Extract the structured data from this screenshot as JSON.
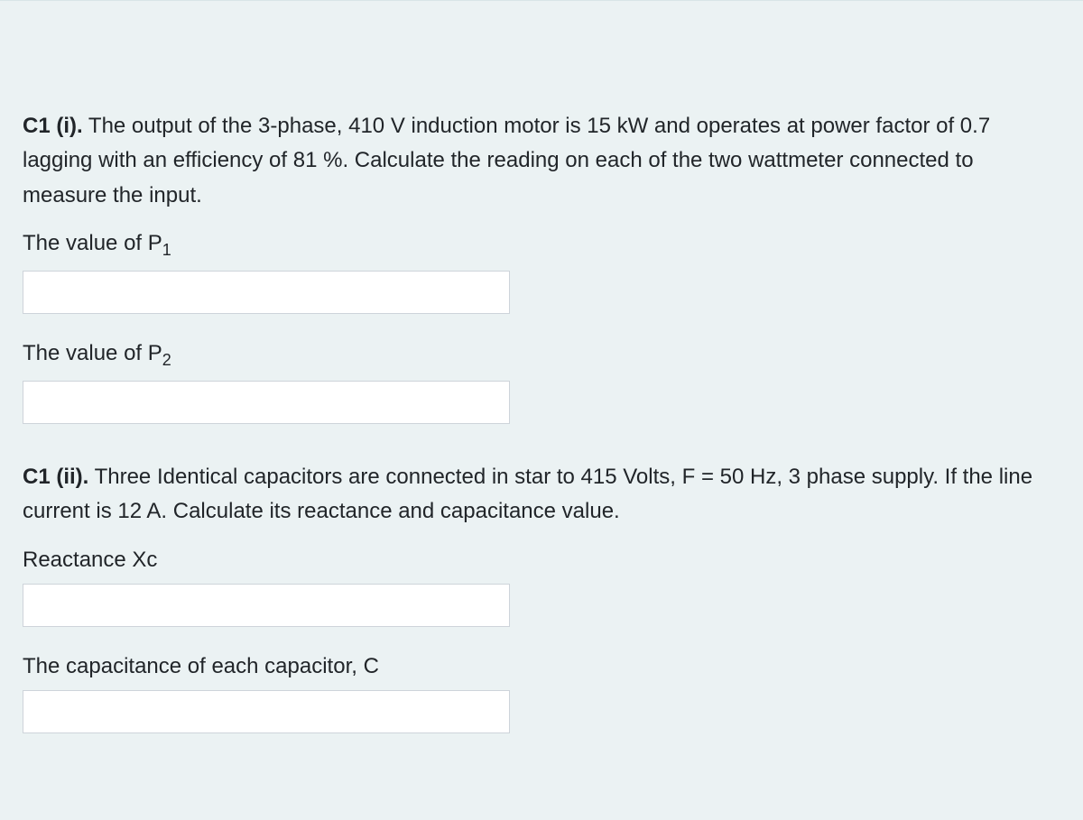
{
  "questions": {
    "q1": {
      "label": "C1 (i).",
      "text": " The output of the 3-phase, 410 V induction motor is 15 kW and operates at power factor of 0.7 lagging with an efficiency of 81 %. Calculate the reading on each of the two wattmeter connected to measure the input."
    },
    "q2": {
      "label": "C1 (ii).",
      "text": " Three Identical capacitors are connected in star to 415 Volts, F = 50 Hz, 3 phase supply. If the line current is 12 A. Calculate its reactance and capacitance value."
    }
  },
  "fields": {
    "p1": {
      "label_prefix": "The value of  P",
      "label_sub": "1",
      "value": ""
    },
    "p2": {
      "label_prefix": "The value of  P",
      "label_sub": "2",
      "value": ""
    },
    "xc": {
      "label": "Reactance Xc",
      "value": ""
    },
    "c": {
      "label": "The capacitance of each capacitor, C",
      "value": ""
    }
  }
}
